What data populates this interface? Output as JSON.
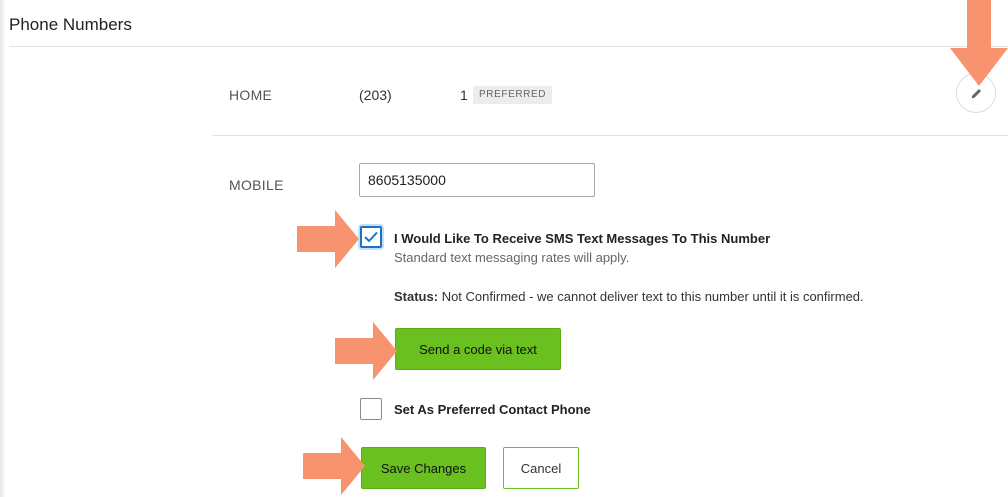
{
  "header": {
    "title": "Phone Numbers"
  },
  "home": {
    "label": "HOME",
    "area_code": "(203)",
    "number_tail": "1",
    "badge": "PREFERRED"
  },
  "mobile": {
    "label": "MOBILE",
    "value": "8605135000",
    "sms_checked": true,
    "sms_title": "I Would Like To Receive SMS Text Messages To This Number",
    "sms_sub": "Standard text messaging rates will apply.",
    "status_label": "Status:",
    "status_text": "Not Confirmed - we cannot deliver text to this number until it is confirmed.",
    "send_code_label": "Send a code via text",
    "preferred_checked": false,
    "preferred_label": "Set As Preferred Contact Phone"
  },
  "actions": {
    "save_label": "Save Changes",
    "cancel_label": "Cancel"
  },
  "icons": {
    "edit": "pencil-icon",
    "check": "checkmark-icon",
    "annotation": "arrow-annotation-icon"
  },
  "colors": {
    "accent_green": "#6ac01f",
    "annotation_orange": "#f7936f",
    "focus_blue": "#1a73c8"
  }
}
